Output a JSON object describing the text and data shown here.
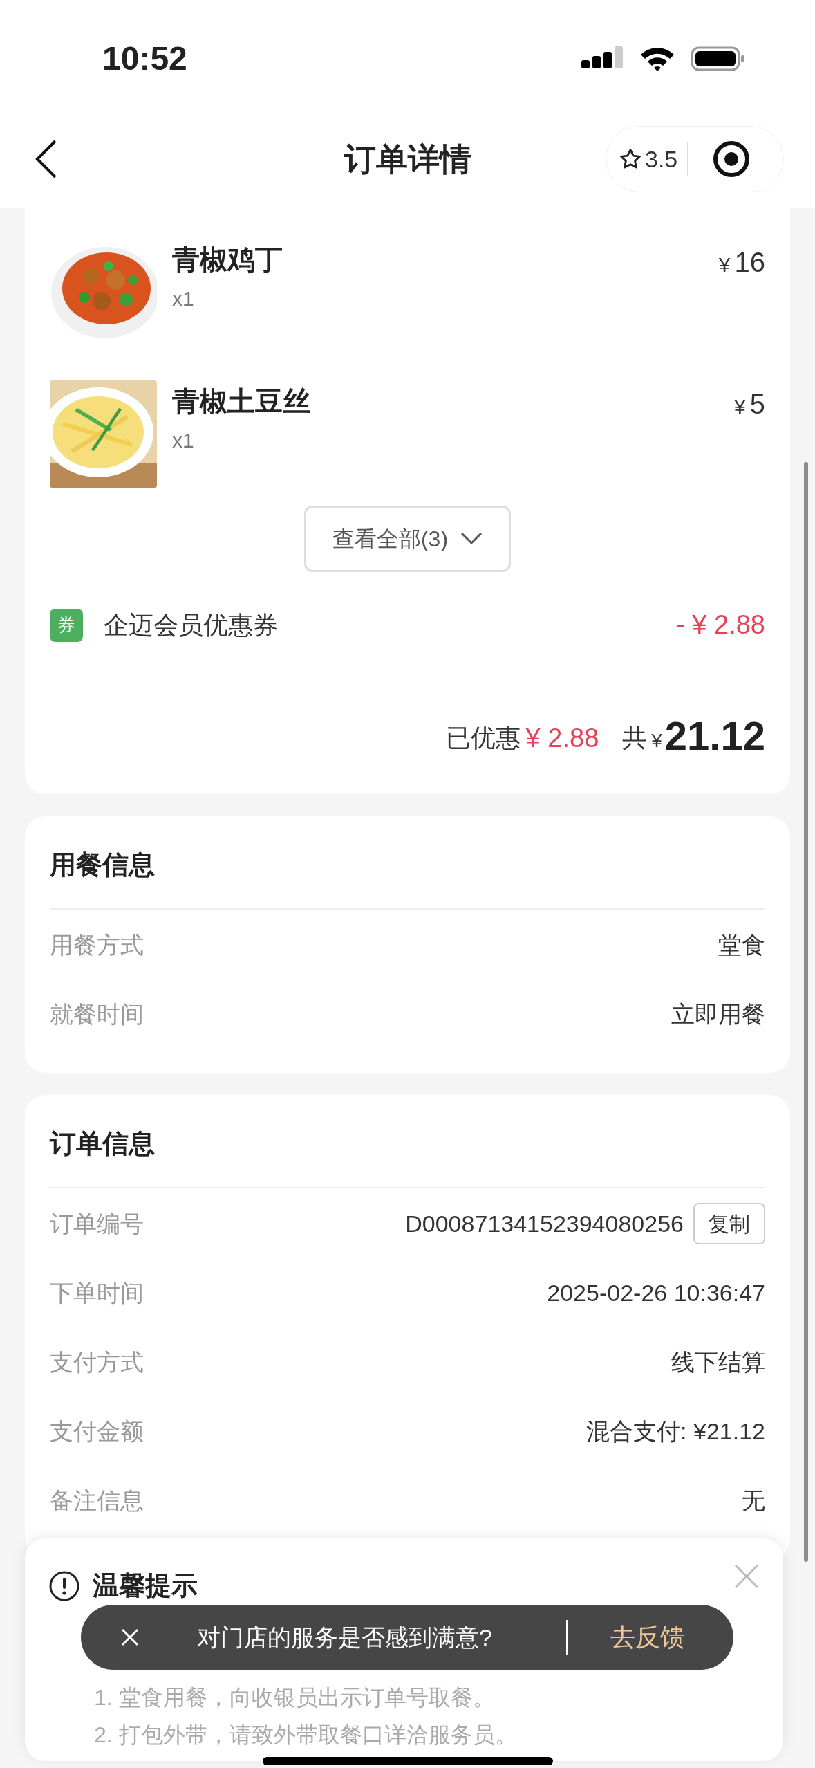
{
  "status_bar": {
    "time": "10:52"
  },
  "nav": {
    "title": "订单详情",
    "rating": "3.5"
  },
  "items": [
    {
      "name": "青椒鸡丁",
      "quantity": "x1",
      "currency": "¥",
      "price": "16"
    },
    {
      "name": "青椒土豆丝",
      "quantity": "x1",
      "currency": "¥",
      "price": "5"
    }
  ],
  "view_all": "查看全部(3)",
  "coupon": {
    "badge": "券",
    "name": "企迈会员优惠券",
    "amount": "- ¥ 2.88"
  },
  "totals": {
    "discount_label": "已优惠",
    "discount_amount": "¥ 2.88",
    "total_label": "共",
    "currency": "¥",
    "total": "21.12"
  },
  "dining": {
    "title": "用餐信息",
    "rows": [
      {
        "label": "用餐方式",
        "value": "堂食"
      },
      {
        "label": "就餐时间",
        "value": "立即用餐"
      }
    ]
  },
  "order": {
    "title": "订单信息",
    "rows": [
      {
        "label": "订单编号",
        "value": "D00087134152394080256",
        "action": "复制"
      },
      {
        "label": "下单时间",
        "value": "2025-02-26 10:36:47"
      },
      {
        "label": "支付方式",
        "value": "线下结算"
      },
      {
        "label": "支付金额",
        "value": "混合支付: ¥21.12"
      },
      {
        "label": "备注信息",
        "value": "无"
      }
    ]
  },
  "tips": {
    "title": "温馨提示",
    "lines": [
      "1. 堂食用餐，向收银员出示订单号取餐。",
      "2. 打包外带，请致外带取餐口详洽服务员。"
    ]
  },
  "toast": {
    "message": "对门店的服务是否感到满意?",
    "action": "去反馈"
  }
}
